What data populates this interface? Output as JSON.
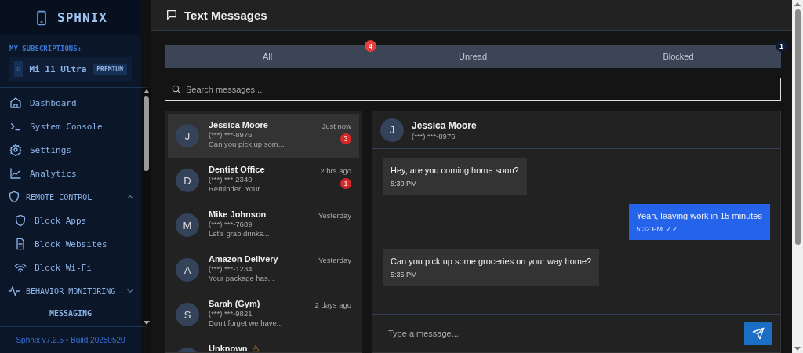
{
  "sidebar": {
    "brand": "SPHNIX",
    "subscriptions_label": "MY SUBSCRIPTIONS:",
    "device": {
      "name": "Mi 11 Ultra",
      "plan": "PREMIUM"
    },
    "nav": [
      {
        "kind": "item",
        "label": "Dashboard"
      },
      {
        "kind": "item",
        "label": "System Console"
      },
      {
        "kind": "item",
        "label": "Settings"
      },
      {
        "kind": "item",
        "label": "Analytics"
      },
      {
        "kind": "section",
        "label": "REMOTE CONTROL",
        "expanded": true,
        "children": [
          {
            "label": "Block Apps"
          },
          {
            "label": "Block Websites"
          },
          {
            "label": "Block Wi-Fi"
          }
        ]
      },
      {
        "kind": "section",
        "label": "BEHAVIOR MONITORING",
        "expanded": false
      },
      {
        "kind": "group",
        "label": "MESSAGING"
      }
    ],
    "footer": "Sphnix v7.2.5 • Build 20250520"
  },
  "page": {
    "title": "Text Messages"
  },
  "tabs": [
    {
      "label": "All",
      "badge": "4"
    },
    {
      "label": "Unread"
    },
    {
      "label": "Blocked",
      "badge": "1"
    }
  ],
  "search": {
    "placeholder": "Search messages..."
  },
  "conversations": [
    {
      "initial": "J",
      "name": "Jessica Moore",
      "phone": "(***) ***-8976",
      "preview": "Can you pick up som...",
      "time": "Just now",
      "unread": "3",
      "selected": true
    },
    {
      "initial": "D",
      "name": "Dentist Office",
      "phone": "(***) ***-2340",
      "preview": "Reminder: Your...",
      "time": "2 hrs ago",
      "unread": "1",
      "selected": false
    },
    {
      "initial": "M",
      "name": "Mike Johnson",
      "phone": "(***) ***-7689",
      "preview": "Let's grab drinks...",
      "time": "Yesterday",
      "selected": false
    },
    {
      "initial": "A",
      "name": "Amazon Delivery",
      "phone": "(***) ***-1234",
      "preview": "Your package has...",
      "time": "Yesterday",
      "selected": false
    },
    {
      "initial": "S",
      "name": "Sarah (Gym)",
      "phone": "(***) ***-9821",
      "preview": "Don't forget we have...",
      "time": "2 days ago",
      "selected": false
    },
    {
      "name": "Unknown",
      "flagged": true,
      "selected": false
    }
  ],
  "chat": {
    "initial": "J",
    "name": "Jessica Moore",
    "phone": "(***) ***-8976",
    "messages": [
      {
        "kind": "incoming",
        "text": "Hey, are you coming home soon?",
        "time": "5:30 PM"
      },
      {
        "kind": "outgoing",
        "text": "Yeah, leaving work in 15 minutes",
        "time": "5:32 PM",
        "status": "✓✓"
      },
      {
        "kind": "incoming",
        "text": "Can you pick up some groceries on your way home?",
        "time": "5:35 PM"
      }
    ],
    "input": {
      "placeholder": "Type a message..."
    }
  }
}
